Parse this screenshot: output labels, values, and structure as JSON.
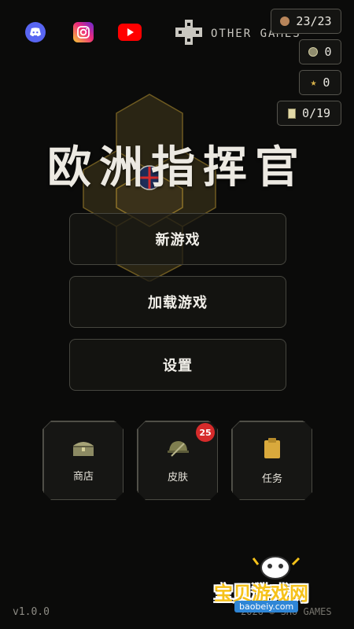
{
  "top_bar": {
    "social_icons": [
      "discord-icon",
      "instagram-icon",
      "youtube-icon"
    ],
    "other_games_label": "OTHER GAMES"
  },
  "counters": {
    "coins": "23/23",
    "medals": "0",
    "stars": "0",
    "tasks": "0/19"
  },
  "title": "欧洲指挥官",
  "menu": {
    "new_game": "新游戏",
    "load_game": "加载游戏",
    "settings": "设置"
  },
  "tiles": {
    "shop": "商店",
    "skins": "皮肤",
    "skins_badge": "25",
    "tasks": "任务"
  },
  "footer": {
    "version": "v1.0.0",
    "copyright": "2026 © SHO GAMES"
  },
  "watermark": {
    "text": "宝贝游戏网",
    "url": "baobeiy.com"
  },
  "colors": {
    "background": "#0b0b0a",
    "accent_gold": "#c9a040",
    "badge_red": "#d62b2b"
  }
}
